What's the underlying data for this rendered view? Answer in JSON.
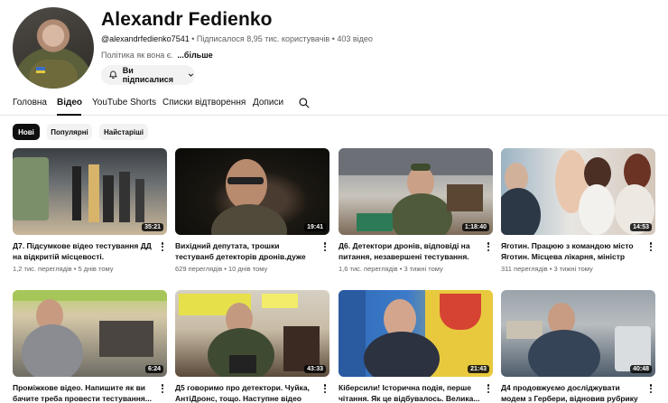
{
  "channel": {
    "name": "Alexandr Fedienko",
    "handle": "@alexandrfedienko7541",
    "subscribers": "Підписалося 8,95 тис. користувачів",
    "videos_count": "403 відео",
    "description": "Політика як вона є.",
    "more_label": "...більше",
    "subscribe_label": "Ви підписалися"
  },
  "tabs": {
    "home": "Головна",
    "videos": "Відео",
    "shorts": "YouTube Shorts",
    "playlists": "Списки відтворення",
    "posts": "Дописи"
  },
  "chips": {
    "new": "Нові",
    "popular": "Популярні",
    "oldest": "Найстаріші"
  },
  "videos": [
    {
      "title": "Д7. Підсумкове відео тестування ДД на відкритій місцевості. Вимірювання...",
      "meta": "1,2 тис. переглядів • 5 днів тому",
      "duration": "35:21"
    },
    {
      "title": "Вихідний депутата, трошки тестуванб детекторів дронів.дуже трошки, дивити...",
      "meta": "629 переглядів • 10 днів тому",
      "duration": "19:41"
    },
    {
      "title": "Д6. Детектори дронів, відповіді на питання, незавершені тестування. Далі...",
      "meta": "1,6 тис. переглядів • 3 тижні тому",
      "duration": "1:18:40"
    },
    {
      "title": "Яготин. Працюю з командою місто Яготин. Місцева лікарня, міністр МОЗ,...",
      "meta": "311 переглядів • 3 тижні тому",
      "duration": "14:53"
    },
    {
      "title": "Проміжкове відео. Напишите як ви бачите треба провести тестування...",
      "meta": "",
      "duration": "6:24"
    },
    {
      "title": "Д5 говоримо про детектори. Чуйка, АнтіДронс, тощо. Наступне відео будуть...",
      "meta": "",
      "duration": "43:33"
    },
    {
      "title": "Кіберсили! Історична подія, перше чітання. Як це відбувалось. Велика...",
      "meta": "",
      "duration": "21:43"
    },
    {
      "title": "Д4 продовжуємо досліджувати модем з Гербери, відновив рубрику розпакуванн...",
      "meta": "",
      "duration": "40:48"
    }
  ],
  "icons": {
    "bell": "bell-icon",
    "chevron": "chevron-down-icon",
    "search": "search-icon",
    "kebab": "more-vert-icon"
  }
}
